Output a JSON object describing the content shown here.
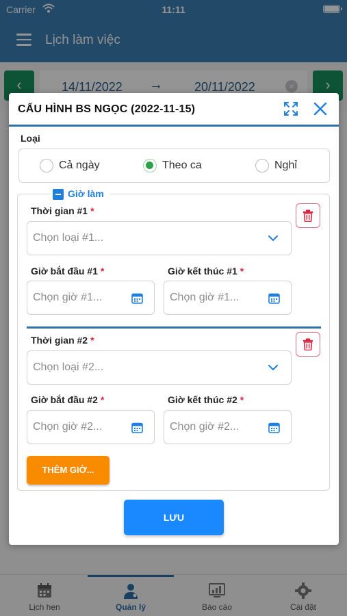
{
  "status_bar": {
    "carrier": "Carrier",
    "time": "11:11"
  },
  "app_header": {
    "title": "Lịch làm việc"
  },
  "date_range": {
    "from": "14/11/2022",
    "to": "20/11/2022"
  },
  "modal": {
    "title": "CẤU HÌNH BS NGỌC (2022-11-15)",
    "type_label": "Loại",
    "type_options": [
      {
        "label": "Cả ngày",
        "checked": false
      },
      {
        "label": "Theo ca",
        "checked": true
      },
      {
        "label": "Nghỉ",
        "checked": false
      }
    ],
    "working_hours_label": "Giờ làm",
    "slots": [
      {
        "time_label": "Thời gian #1",
        "type_placeholder": "Chọn loại #1...",
        "start_label": "Giờ bắt đầu #1",
        "start_placeholder": "Chọn giờ #1...",
        "end_label": "Giờ kết thúc #1",
        "end_placeholder": "Chọn giờ #1..."
      },
      {
        "time_label": "Thời gian #2",
        "type_placeholder": "Chọn loại #2...",
        "start_label": "Giờ bắt đầu #2",
        "start_placeholder": "Chọn giờ #2...",
        "end_label": "Giờ kết thúc #2",
        "end_placeholder": "Chọn giờ #2..."
      }
    ],
    "required_mark": "*",
    "add_button": "THÊM GIỜ...",
    "save_button": "LƯU"
  },
  "tab_bar": {
    "items": [
      {
        "label": "Lịch hẹn",
        "icon": "calendar-icon",
        "active": false
      },
      {
        "label": "Quản lý",
        "icon": "doctor-icon",
        "active": true
      },
      {
        "label": "Báo cáo",
        "icon": "report-icon",
        "active": false
      },
      {
        "label": "Cài đặt",
        "icon": "gear-icon",
        "active": false
      }
    ]
  },
  "colors": {
    "header": "#3d7fb4",
    "accent_blue": "#1a89ff",
    "orange": "#f98b00",
    "radio_green": "#2ea24a",
    "danger": "#e26b82",
    "nav_green": "#17905c"
  }
}
